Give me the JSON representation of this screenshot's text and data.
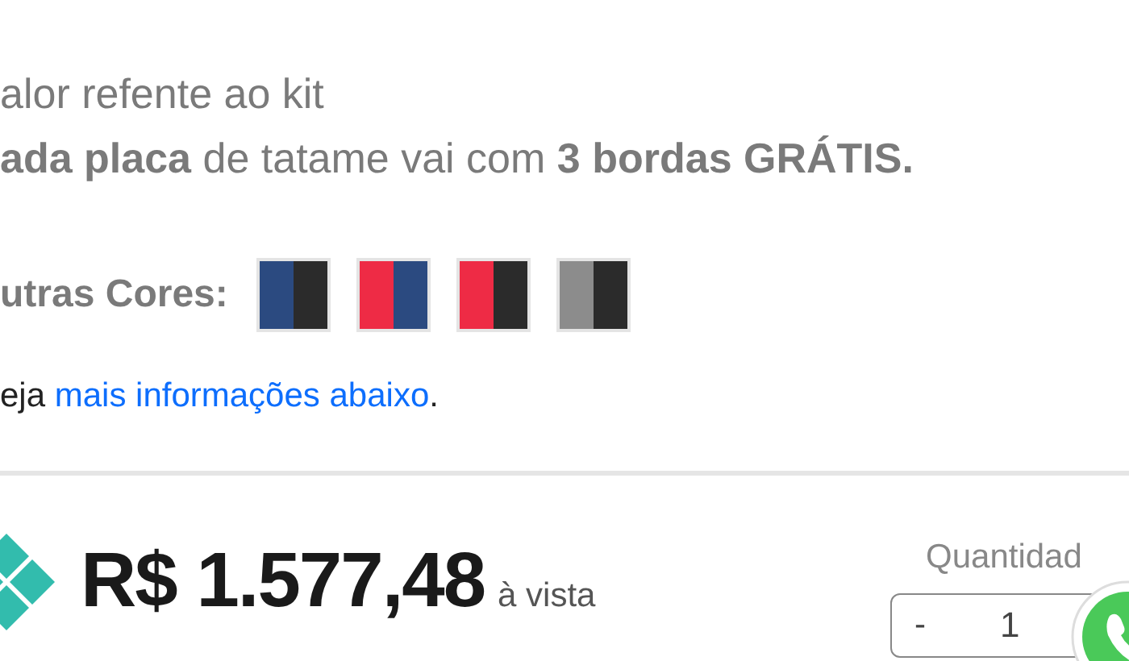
{
  "description": [
    "alor refente ao kit",
    "**ada placa** de tatame vai com **3 bordas GRÁTIS.**"
  ],
  "other_colors": {
    "label": "utras Cores:",
    "swatches": [
      {
        "halves": [
          {
            "color": "#2b4a80"
          },
          {
            "color": "#2b2b2b"
          }
        ]
      },
      {
        "halves": [
          {
            "color": "#ee2b45"
          },
          {
            "color": "#2b4a80"
          }
        ]
      },
      {
        "halves": [
          {
            "color": "#ee2b45"
          },
          {
            "color": "#2b2b2b"
          }
        ]
      },
      {
        "halves": [
          {
            "color": "#8c8c8c"
          },
          {
            "color": "#2b2b2b"
          }
        ]
      }
    ]
  },
  "more_info": {
    "prefix": "eja",
    "link": "mais informações abaixo",
    "suffix": "."
  },
  "price": {
    "amount": "R$ 1.577,48",
    "note": "à vista"
  },
  "quantity": {
    "label": "Quantidad",
    "minus": "-",
    "value": "1"
  }
}
